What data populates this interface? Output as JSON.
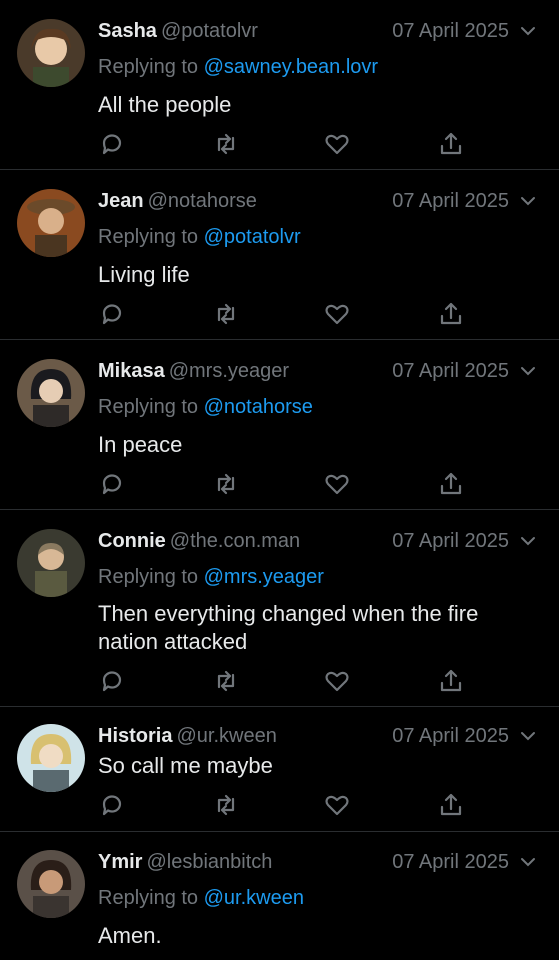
{
  "colors": {
    "background": "#000000",
    "text": "#e7e9ea",
    "muted": "#71767b",
    "link": "#1d9bf0",
    "divider": "#2a2d30"
  },
  "tweets": [
    {
      "name": "Sasha",
      "handle": "@potatolvr",
      "date": "07 April 2025",
      "replying_label": "Replying to",
      "replying_to": "@sawney.bean.lovr",
      "text": "All the people"
    },
    {
      "name": "Jean",
      "handle": "@notahorse",
      "date": "07 April 2025",
      "replying_label": "Replying to",
      "replying_to": "@potatolvr",
      "text": "Living life"
    },
    {
      "name": "Mikasa",
      "handle": "@mrs.yeager",
      "date": "07 April 2025",
      "replying_label": "Replying to",
      "replying_to": "@notahorse",
      "text": "In peace"
    },
    {
      "name": "Connie",
      "handle": "@the.con.man",
      "date": "07 April 2025",
      "replying_label": "Replying to",
      "replying_to": "@mrs.yeager",
      "text": "Then everything changed when the fire nation attacked"
    },
    {
      "name": "Historia",
      "handle": "@ur.kween",
      "date": "07 April 2025",
      "text": "So call me maybe"
    },
    {
      "name": "Ymir",
      "handle": "@lesbianbitch",
      "date": "07 April 2025",
      "replying_label": "Replying to",
      "replying_to": "@ur.kween",
      "text": "Amen."
    }
  ],
  "icons": {
    "reply": "reply-icon",
    "retweet": "retweet-icon",
    "like": "like-icon",
    "share": "share-icon",
    "menu": "chevron-down-icon"
  }
}
